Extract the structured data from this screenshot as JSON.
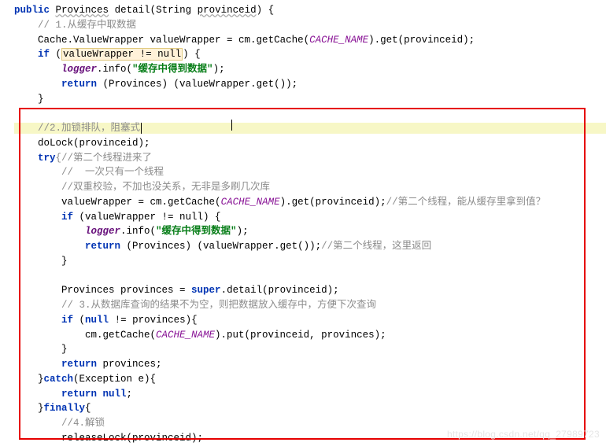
{
  "code": {
    "line01_public": "public",
    "line01_ret": "Provinces",
    "line01_fn": "detail",
    "line01_param_type": "String",
    "line01_param_name": "provinceid",
    "line02_cmt": "// 1.从缓存中取数据",
    "line03_lhs": "Cache.ValueWrapper valueWrapper = cm.getCache(",
    "line03_cn": "CACHE_NAME",
    "line03_rhs": ").get(provinceid);",
    "line04_if": "if",
    "line04_cond": "valueWrapper != null",
    "line05_logger": "logger",
    "line05_info": ".info(",
    "line05_str": "\"缓存中得到数据\"",
    "line05_end": ");",
    "line06_return": "return",
    "line06_rest": " (Provinces) (valueWrapper.get());",
    "line08_cmt": "//2.加锁排队，阻塞式",
    "line09_dolock": "doLock(provinceid);",
    "line10_try": "try",
    "line10_cmt": "{//第二个线程进来了",
    "line11_cmt": "//  一次只有一个线程",
    "line12_cmt": "//双重校验，不加也没关系，无非是多刷几次库",
    "line13_a": "valueWrapper = cm.getCache(",
    "line13_cn": "CACHE_NAME",
    "line13_b": ").get(provinceid);",
    "line13_cmt": "//第二个线程，能从缓存里拿到值？",
    "line14_if": "if",
    "line14_cond": " (valueWrapper != null) {",
    "line15_logger": "logger",
    "line15_info": ".info(",
    "line15_str": "\"缓存中得到数据\"",
    "line15_end": ");",
    "line16_return": "return",
    "line16_rest": " (Provinces) (valueWrapper.get());",
    "line16_cmt": "//第二个线程，这里返回",
    "line19_a": "Provinces provinces = ",
    "line19_super": "super",
    "line19_b": ".detail(provinceid);",
    "line20_cmt": "// 3.从数据库查询的结果不为空，则把数据放入缓存中，方便下次查询",
    "line21_if": "if",
    "line21_cond": " (",
    "line21_null": "null",
    "line21_rest": " != provinces){",
    "line22_a": "cm.getCache(",
    "line22_cn": "CACHE_NAME",
    "line22_b": ").put(provinceid, provinces);",
    "line24_return": "return",
    "line24_rest": " provinces;",
    "line25_catch": "catch",
    "line25_rest": "(Exception e){",
    "line26_return": "return null",
    "line26_semi": ";",
    "line27_finally": "finally",
    "line28_cmt": "//4.解锁",
    "line29_rel": "releaseLock(provinceid);"
  },
  "watermark": "https://blog.csdn.net/qq_27989723"
}
